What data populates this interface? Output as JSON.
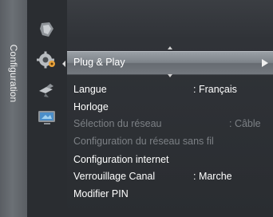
{
  "side_tab": {
    "label": "Configuration"
  },
  "icons": [
    "tv-icon",
    "gear-icon",
    "satellite-icon",
    "input-icon"
  ],
  "highlighted": {
    "label": "Plug & Play"
  },
  "menu_items": [
    {
      "label": "Langue",
      "value": ": Français",
      "disabled": false
    },
    {
      "label": "Horloge",
      "value": "",
      "disabled": false
    },
    {
      "label": "Sélection du réseau",
      "value": ": Câble",
      "disabled": true
    },
    {
      "label": "Configuration du réseau sans fil",
      "value": "",
      "disabled": true
    },
    {
      "label": "Configuration internet",
      "value": "",
      "disabled": false
    },
    {
      "label": "Verrouillage Canal",
      "value": ": Marche",
      "disabled": false
    },
    {
      "label": "Modifier PIN",
      "value": "",
      "disabled": false
    }
  ],
  "colors": {
    "highlight": "#7d8389",
    "disabled_text": "#7c8085",
    "background": "#2a2d31"
  }
}
